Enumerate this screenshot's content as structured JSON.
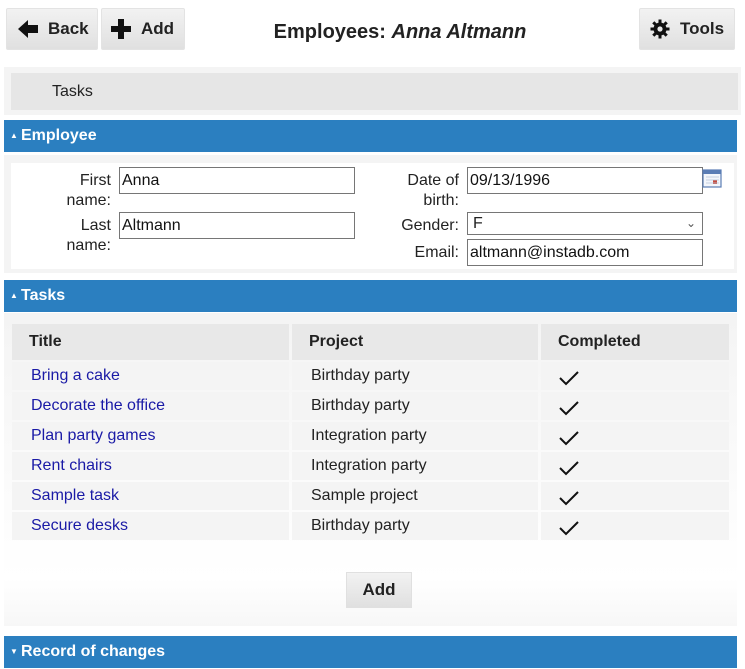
{
  "toolbar": {
    "back_label": "Back",
    "add_label": "Add",
    "tools_label": "Tools",
    "title_prefix": "Employees",
    "title_sep": ": ",
    "title_name": "Anna Altmann"
  },
  "tabs": [
    {
      "label": "Tasks"
    }
  ],
  "employee": {
    "section_label": "Employee",
    "first_name_label": "First name:",
    "first_name_value": "Anna",
    "last_name_label": "Last name:",
    "last_name_value": "Altmann",
    "dob_label": "Date of birth:",
    "dob_value": "09/13/1996",
    "gender_label": "Gender:",
    "gender_value": "F",
    "email_label": "Email:",
    "email_value": "altmann@instadb.com"
  },
  "tasks": {
    "section_label": "Tasks",
    "columns": [
      "Title",
      "Project",
      "Completed"
    ],
    "rows": [
      {
        "title": "Bring a cake",
        "project": "Birthday party",
        "completed": true
      },
      {
        "title": "Decorate the office",
        "project": "Birthday party",
        "completed": true
      },
      {
        "title": "Plan party games",
        "project": "Integration party",
        "completed": true
      },
      {
        "title": "Rent chairs",
        "project": "Integration party",
        "completed": true
      },
      {
        "title": "Sample task",
        "project": "Sample project",
        "completed": true
      },
      {
        "title": "Secure desks",
        "project": "Birthday party",
        "completed": true
      }
    ],
    "add_label": "Add"
  },
  "changes": {
    "section_label": "Record of changes"
  },
  "colors": {
    "section_bar": "#2b7fc0",
    "link": "#1a1aa6"
  }
}
